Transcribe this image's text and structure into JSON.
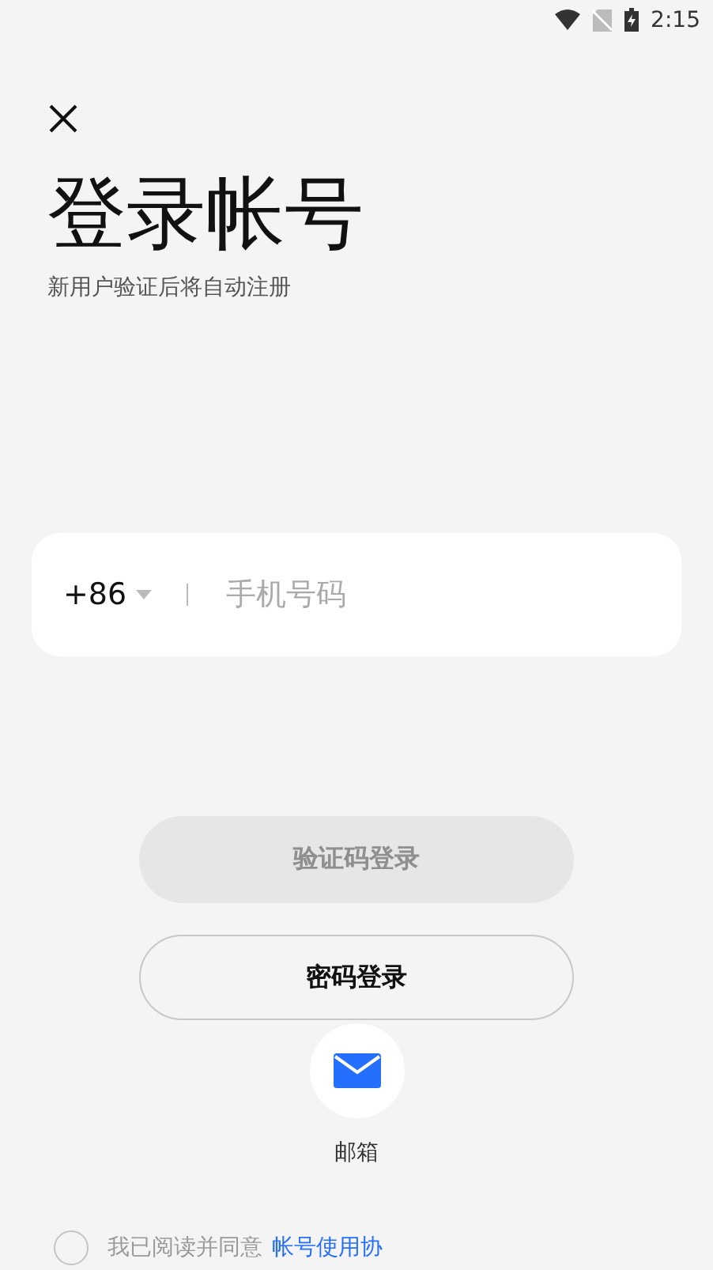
{
  "status_bar": {
    "time": "2:15"
  },
  "title": "登录帐号",
  "subtitle": "新用户验证后将自动注册",
  "phone_field": {
    "country_code": "+86",
    "placeholder": "手机号码"
  },
  "buttons": [
    {
      "label": "验证码登录",
      "kind": "filled",
      "disabled": true
    },
    {
      "label": "密码登录",
      "kind": "outline",
      "disabled": false
    }
  ],
  "email_option": {
    "label": "邮箱"
  },
  "agreement": {
    "checked": false,
    "text": "我已阅读并同意",
    "link": "帐号使用协"
  }
}
